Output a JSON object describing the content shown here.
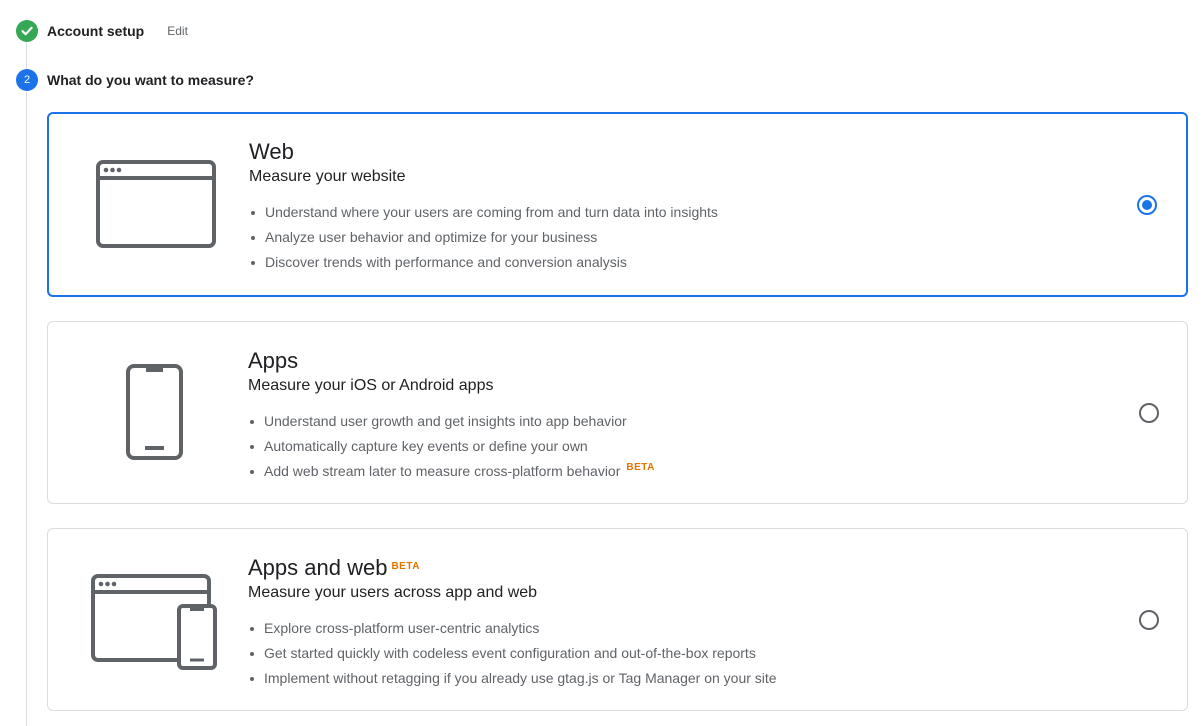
{
  "steps": [
    {
      "label": "Account setup",
      "edit_label": "Edit",
      "status": "complete"
    },
    {
      "label": "What do you want to measure?",
      "number": "2",
      "status": "active"
    }
  ],
  "options": [
    {
      "title": "Web",
      "subtitle": "Measure your website",
      "illustration": "browser-window-icon",
      "selected": true,
      "bullets": [
        "Understand where your users are coming from and turn data into insights",
        "Analyze user behavior and optimize for your business",
        "Discover trends with performance and conversion analysis"
      ]
    },
    {
      "title": "Apps",
      "subtitle": "Measure your iOS or Android apps",
      "illustration": "mobile-phone-icon",
      "selected": false,
      "bullets": [
        "Understand user growth and get insights into app behavior",
        "Automatically capture key events or define your own",
        "Add web stream later to measure cross-platform behavior"
      ],
      "bullet_badge": "BETA"
    },
    {
      "title": "Apps and web",
      "title_badge": "BETA",
      "subtitle": "Measure your users across app and web",
      "illustration": "browser-and-phone-icon",
      "selected": false,
      "bullets": [
        "Explore cross-platform user-centric analytics",
        "Get started quickly with codeless event configuration and out-of-the-box reports",
        "Implement without retagging if you already use gtag.js or Tag Manager on your site"
      ]
    }
  ],
  "colors": {
    "accent": "#1a73e8",
    "success": "#34a853",
    "beta": "#e37400",
    "border": "#dadce0",
    "icon_stroke": "#5f6368"
  }
}
